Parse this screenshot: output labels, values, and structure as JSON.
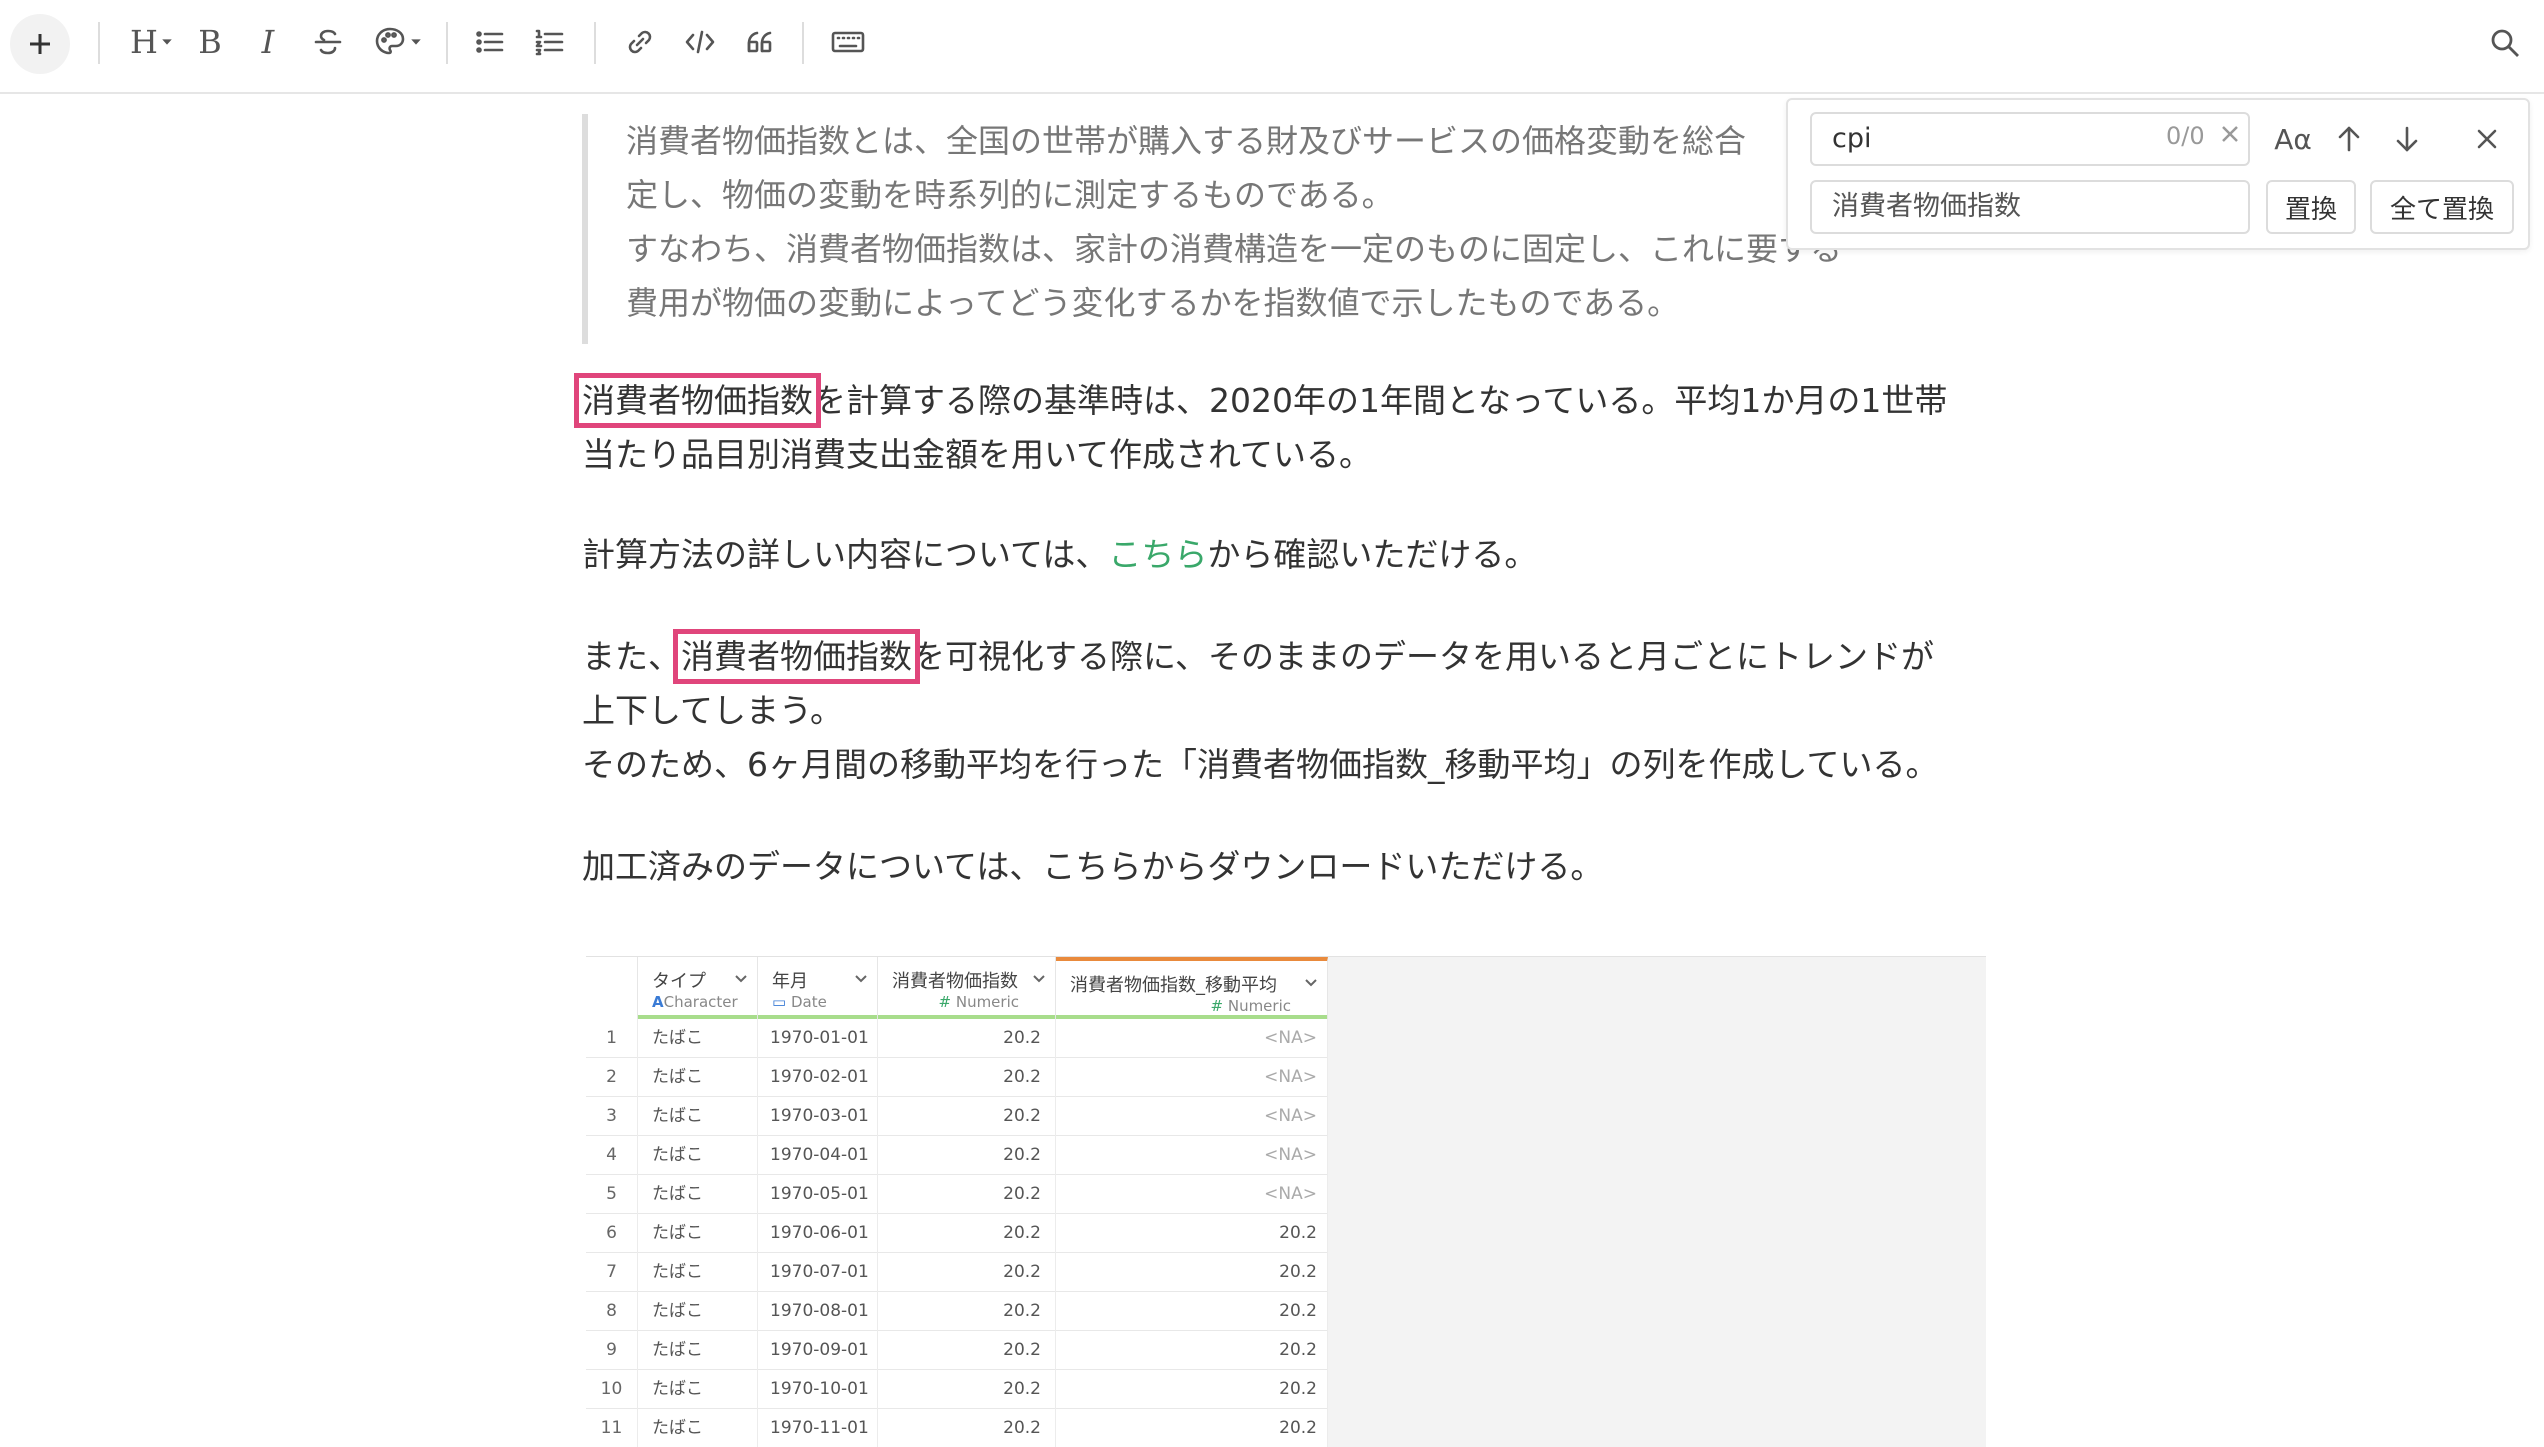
{
  "toolbar": {
    "heading_label": "H",
    "bold_label": "B",
    "italic_label": "I"
  },
  "blockquote": {
    "lines": [
      "消費者物価指数とは、全国の世帯が購入する財及びサービスの価格変動を総合",
      "定し、物価の変動を時系列的に測定するものである。",
      "すなわち、消費者物価指数は、家計の消費構造を一定のものに固定し、これに要する",
      "費用が物価の変動によってどう変化するかを指数値で示したものである。"
    ]
  },
  "paragraphs": {
    "p1_highlight": "消費者物価指数",
    "p1_rest": "を計算する際の基準時は、2020年の1年間となっている。平均1か月の1世帯",
    "p1_line2": "当たり品目別消費支出金額を用いて作成されている。",
    "p2_before": "計算方法の詳しい内容については、",
    "p2_link": "こちら",
    "p2_after": "から確認いただける。",
    "p3_before": "また、",
    "p3_highlight": "消費者物価指数",
    "p3_rest": "を可視化する際に、そのままのデータを用いると月ごとにトレンドが",
    "p3_line2": "上下してしまう。",
    "p3_line3": "そのため、6ヶ月間の移動平均を行った「消費者物価指数_移動平均」の列を作成している。",
    "p4": "加工済みのデータについては、こちらからダウンロードいただける。"
  },
  "table": {
    "columns": [
      {
        "name": "タイプ",
        "type": "Character",
        "type_icon": "A"
      },
      {
        "name": "年月",
        "type": "Date",
        "type_icon": "calendar-icon"
      },
      {
        "name": "消費者物価指数",
        "type": "Numeric",
        "type_icon": "#"
      },
      {
        "name": "消費者物価指数_移動平均",
        "type": "Numeric",
        "type_icon": "#"
      }
    ],
    "rows": [
      {
        "n": "1",
        "type": "たばこ",
        "date": "1970-01-01",
        "cpi": "20.2",
        "ma": "<NA>"
      },
      {
        "n": "2",
        "type": "たばこ",
        "date": "1970-02-01",
        "cpi": "20.2",
        "ma": "<NA>"
      },
      {
        "n": "3",
        "type": "たばこ",
        "date": "1970-03-01",
        "cpi": "20.2",
        "ma": "<NA>"
      },
      {
        "n": "4",
        "type": "たばこ",
        "date": "1970-04-01",
        "cpi": "20.2",
        "ma": "<NA>"
      },
      {
        "n": "5",
        "type": "たばこ",
        "date": "1970-05-01",
        "cpi": "20.2",
        "ma": "<NA>"
      },
      {
        "n": "6",
        "type": "たばこ",
        "date": "1970-06-01",
        "cpi": "20.2",
        "ma": "20.2"
      },
      {
        "n": "7",
        "type": "たばこ",
        "date": "1970-07-01",
        "cpi": "20.2",
        "ma": "20.2"
      },
      {
        "n": "8",
        "type": "たばこ",
        "date": "1970-08-01",
        "cpi": "20.2",
        "ma": "20.2"
      },
      {
        "n": "9",
        "type": "たばこ",
        "date": "1970-09-01",
        "cpi": "20.2",
        "ma": "20.2"
      },
      {
        "n": "10",
        "type": "たばこ",
        "date": "1970-10-01",
        "cpi": "20.2",
        "ma": "20.2"
      },
      {
        "n": "11",
        "type": "たばこ",
        "date": "1970-11-01",
        "cpi": "20.2",
        "ma": "20.2"
      }
    ]
  },
  "find_replace": {
    "search_value": "cpi",
    "match_count": "0/0",
    "case_label": "Aα",
    "replace_value": "消費者物価指数",
    "replace_button": "置換",
    "replace_all_button": "全て置換"
  },
  "colors": {
    "highlight": "#e0457b",
    "link": "#3aa86a",
    "accent_orange": "#e98a3c",
    "header_bar": "#a8dd8c"
  }
}
